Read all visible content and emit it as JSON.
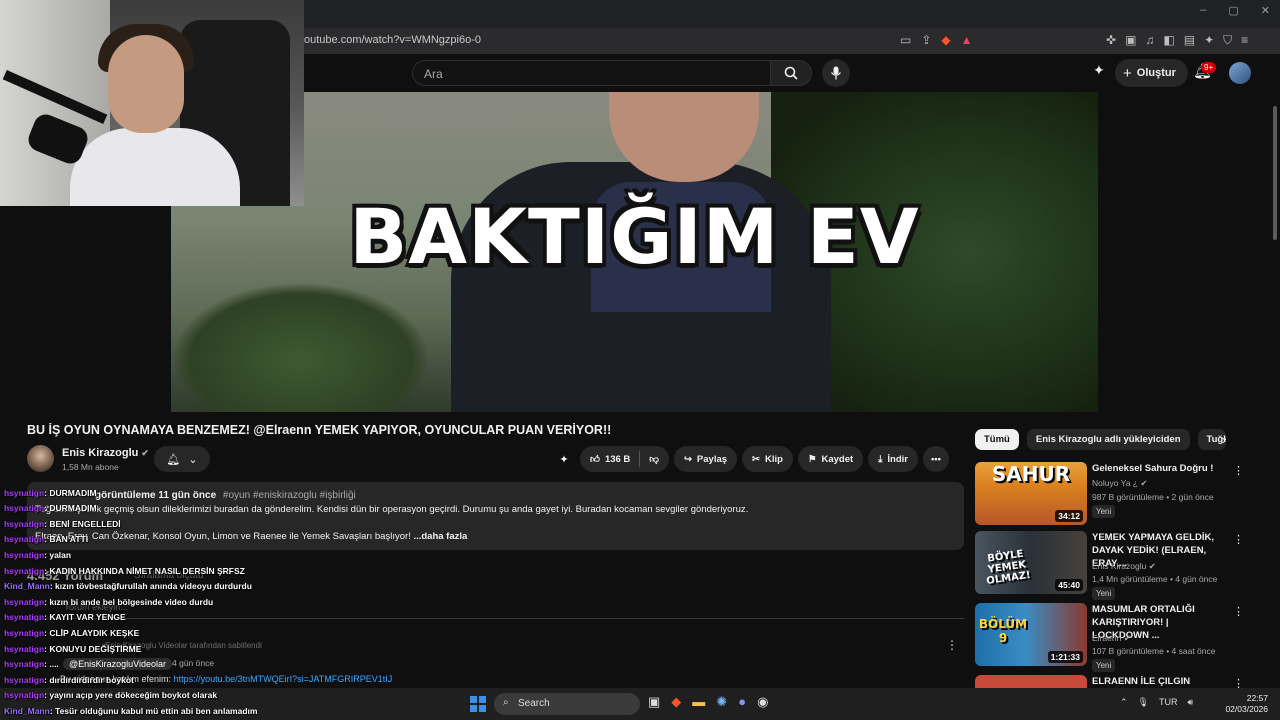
{
  "browser": {
    "url": "outube.com/watch?v=WMNgzpi6o-0",
    "window_controls": [
      "–",
      "▢",
      "✕"
    ]
  },
  "header": {
    "search_placeholder": "Ara",
    "create_label": "Oluştur",
    "notif_count": "9+"
  },
  "video": {
    "overlay_text": "BAKTIĞIM EV",
    "title": "BU İŞ OYUN OYNAMAYA BENZEMEZ! @Elraenn YEMEK YAPIYOR, OYUNCULAR PUAN VERİYOR!!",
    "channel": "Enis Kirazoglu",
    "subscribers": "1,58 Mn abone",
    "likes": "136 B",
    "share_label": "Paylaş",
    "clip_label": "Klip",
    "save_label": "Kaydet",
    "download_label": "İndir"
  },
  "description": {
    "views_time": "görüntüleme  11 gün önce",
    "tags": "#oyun #eniskirazoglu #işbirliği",
    "line1": "Tuğkan'a çoook geçmiş olsun dileklerimizi buradan da gönderelim. Kendisi dün bir operasyon geçirdi. Durumu şu anda gayet iyi. Buradan kocaman sevgiler gönderiyoruz.",
    "line2": "Elraen, Eray, Can Özkenar, Konsol Oyun, Limon ve Raenee ile Yemek Savaşları başlıyor!",
    "more": "...daha fazla"
  },
  "comments": {
    "count_label": "4.452 Yorum",
    "sort_label": "Sıralama ölçütü",
    "add_placeholder": "Yorum ekleyin...",
    "pinned": "Enis Kirazoglu Videolar tarafından sabitlendi",
    "author": "@EnisKirazogluVideolar",
    "time": "4 gün önce",
    "text": "Bu videonun katılım efenim: ",
    "link": "https://youtu.be/3tnMTWQEirI?si=JATMFGRIRPEV1tIJ"
  },
  "chat": [
    {
      "user": "hsynatign",
      "msg": ": DURMADIM"
    },
    {
      "user": "hsynatign",
      "msg": ": DURMADIM"
    },
    {
      "user": "hsynatign",
      "msg": ": BENİ ENGELLEDİ"
    },
    {
      "user": "hsynatign",
      "msg": ": BAN ATTI"
    },
    {
      "user": "hsynatign",
      "msg": ": yalan"
    },
    {
      "user": "hsynatign",
      "msg": ": KADIN HAKKINDA NİMET NASIL DERSİN ŞRFSZ"
    },
    {
      "user": "Kind_Mann",
      "msg": ": kızın tövbestağfurullah anında videoyu durdurdu"
    },
    {
      "user": "hsynatign",
      "msg": ": kızın bi ande bel bölgesinde video durdu"
    },
    {
      "user": "hsynatign",
      "msg": ": KAYIT VAR YENGE"
    },
    {
      "user": "hsynatign",
      "msg": ": CLİP ALAYDIK KEŞKE"
    },
    {
      "user": "hsynatign",
      "msg": ": KONUYU DEĞİŞTİRME"
    },
    {
      "user": "hsynatign",
      "msg": ": ...."
    },
    {
      "user": "hsynatign",
      "msg": ": dırdırdırdırdır boykot"
    },
    {
      "user": "hsynatign",
      "msg": ": yayını açıp yere dökeceğim boykot olarak"
    },
    {
      "user": "Kind_Mann",
      "msg": ": Tesür olduğunu kabul mü ettin abi ben anlamadım"
    }
  ],
  "sidebar": {
    "chips": [
      "Tümü",
      "Enis Kirazoglu adlı yükleyiciden",
      "Tuğkan"
    ],
    "videos": [
      {
        "thumb_text": "SAHUR",
        "duration": "34:12",
        "title": "Geleneksel Sahura Doğru !",
        "channel": "Noluyo Ya ¿",
        "meta": "987 B görüntüleme • 2 gün önce",
        "badge": "Yeni"
      },
      {
        "thumb_text": "BÖYLE YEMEK OLMAZ!",
        "duration": "45:40",
        "title": "YEMEK YAPMAYA GELDİK, DAYAK YEDİK! (ELRAEN, ERAY,...",
        "channel": "Enis Kirazoglu",
        "meta": "1,4 Mn görüntüleme • 4 gün önce",
        "badge": "Yeni"
      },
      {
        "thumb_text": "BÖLÜM 9",
        "duration": "1:21:33",
        "title": "MASUMLAR ORTALIĞI KARIŞTIRIYOR! | LOCKDOWN ...",
        "channel": "Elraenn",
        "meta": "107 B görüntüleme • 4 saat önce",
        "badge": "Yeni"
      },
      {
        "thumb_text": "",
        "duration": "",
        "title": "ELRAENN İLE ÇILGIN ÜRÜNLER",
        "channel": "",
        "meta": "",
        "badge": ""
      }
    ]
  },
  "taskbar": {
    "search_label": "Search",
    "lang": "TUR",
    "time": "22:57",
    "date": "02/03/2026"
  }
}
